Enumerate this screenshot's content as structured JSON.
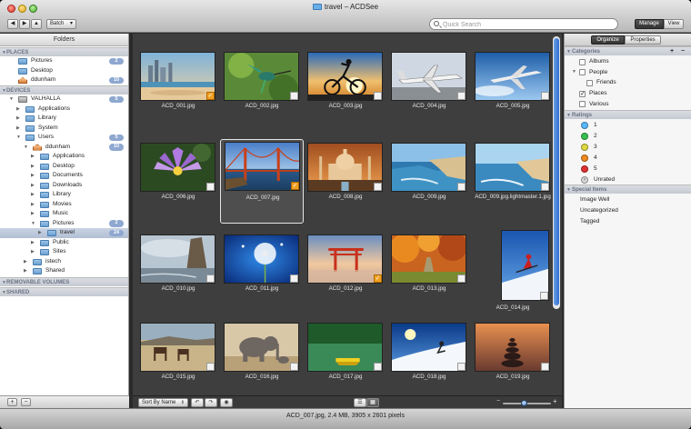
{
  "window": {
    "title": "travel – ACDSee",
    "buttons": {
      "back": "◀",
      "forward": "▶",
      "up": "▲",
      "batch": "Batch"
    },
    "search_placeholder": "Quick Search",
    "modes": {
      "manage": "Manage",
      "view": "View"
    }
  },
  "sidebar": {
    "header": "Folders",
    "places_label": "PLACES",
    "devices_label": "DEVICES",
    "removable_label": "REMOVABLE VOLUMES",
    "shared_label": "SHARED",
    "places": [
      {
        "label": "Pictures",
        "badge": "2"
      },
      {
        "label": "Desktop",
        "badge": ""
      },
      {
        "label": "ddunham",
        "badge": "10"
      }
    ],
    "devices": [
      {
        "label": "VALHALLA",
        "badge": "5"
      },
      {
        "label": "Applications",
        "badge": ""
      },
      {
        "label": "Library",
        "badge": ""
      },
      {
        "label": "System",
        "badge": ""
      },
      {
        "label": "Users",
        "badge": "5"
      },
      {
        "label": "ddunham",
        "badge": "10"
      },
      {
        "label": "Applications",
        "badge": ""
      },
      {
        "label": "Desktop",
        "badge": ""
      },
      {
        "label": "Documents",
        "badge": ""
      },
      {
        "label": "Downloads",
        "badge": ""
      },
      {
        "label": "Library",
        "badge": ""
      },
      {
        "label": "Movies",
        "badge": ""
      },
      {
        "label": "Music",
        "badge": ""
      },
      {
        "label": "Pictures",
        "badge": "2"
      },
      {
        "label": "travel",
        "badge": "24"
      },
      {
        "label": "Public",
        "badge": ""
      },
      {
        "label": "Sites",
        "badge": ""
      },
      {
        "label": "istech",
        "badge": ""
      },
      {
        "label": "Shared",
        "badge": ""
      }
    ],
    "add_label": "+",
    "remove_label": "−"
  },
  "thumbnails": [
    {
      "file": "ACD_001.jpg",
      "scene": "beach-city",
      "checked": true
    },
    {
      "file": "ACD_002.jpg",
      "scene": "hummingbird",
      "checked": false
    },
    {
      "file": "ACD_003.jpg",
      "scene": "cyclist",
      "checked": false
    },
    {
      "file": "ACD_004.jpg",
      "scene": "jet-ground",
      "checked": false
    },
    {
      "file": "ACD_005.jpg",
      "scene": "jet-sky",
      "checked": false
    },
    {
      "file": "ACD_006.jpg",
      "scene": "lotus",
      "checked": false
    },
    {
      "file": "ACD_007.jpg",
      "scene": "bridge",
      "checked": true
    },
    {
      "file": "ACD_008.jpg",
      "scene": "tajmahal",
      "checked": false
    },
    {
      "file": "ACD_009.jpg",
      "scene": "coast",
      "checked": false
    },
    {
      "file": "ACD_009.jpg.lightmaster.1.jpg",
      "scene": "coast2",
      "checked": false
    },
    {
      "file": "ACD_010.jpg",
      "scene": "cliff",
      "checked": false
    },
    {
      "file": "ACD_011.jpg",
      "scene": "dandelion",
      "checked": false
    },
    {
      "file": "ACD_012.jpg",
      "scene": "torii",
      "checked": true
    },
    {
      "file": "ACD_013.jpg",
      "scene": "autumn",
      "checked": false
    },
    {
      "file": "ACD_014.jpg",
      "scene": "skier",
      "checked": false
    },
    {
      "file": "ACD_015.jpg",
      "scene": "horses",
      "checked": false
    },
    {
      "file": "ACD_016.jpg",
      "scene": "elephant",
      "checked": false
    },
    {
      "file": "ACD_017.jpg",
      "scene": "lake",
      "checked": false
    },
    {
      "file": "ACD_018.jpg",
      "scene": "ski-jump",
      "checked": false
    },
    {
      "file": "ACD_019.jpg",
      "scene": "stones",
      "checked": false
    }
  ],
  "center_bar": {
    "sort": "Sort By Name"
  },
  "organize": {
    "tabs": {
      "organize": "Organize",
      "properties": "Properties"
    },
    "categories_label": "Categories",
    "categories": [
      "Albums",
      "People",
      "Friends",
      "Places",
      "Various"
    ],
    "ratings_label": "Ratings",
    "ratings": [
      "1",
      "2",
      "3",
      "4",
      "5",
      "Unrated"
    ],
    "rating_colors": [
      "#58b8ff",
      "#38c050",
      "#e0d840",
      "#f08a20",
      "#e03030",
      "#d8d8d8"
    ],
    "special_label": "Special Items",
    "special": [
      "Image Well",
      "Uncategorized",
      "Tagged"
    ]
  },
  "status": "ACD_007.jpg, 2.4 MB, 3905 x 2601 pixels"
}
